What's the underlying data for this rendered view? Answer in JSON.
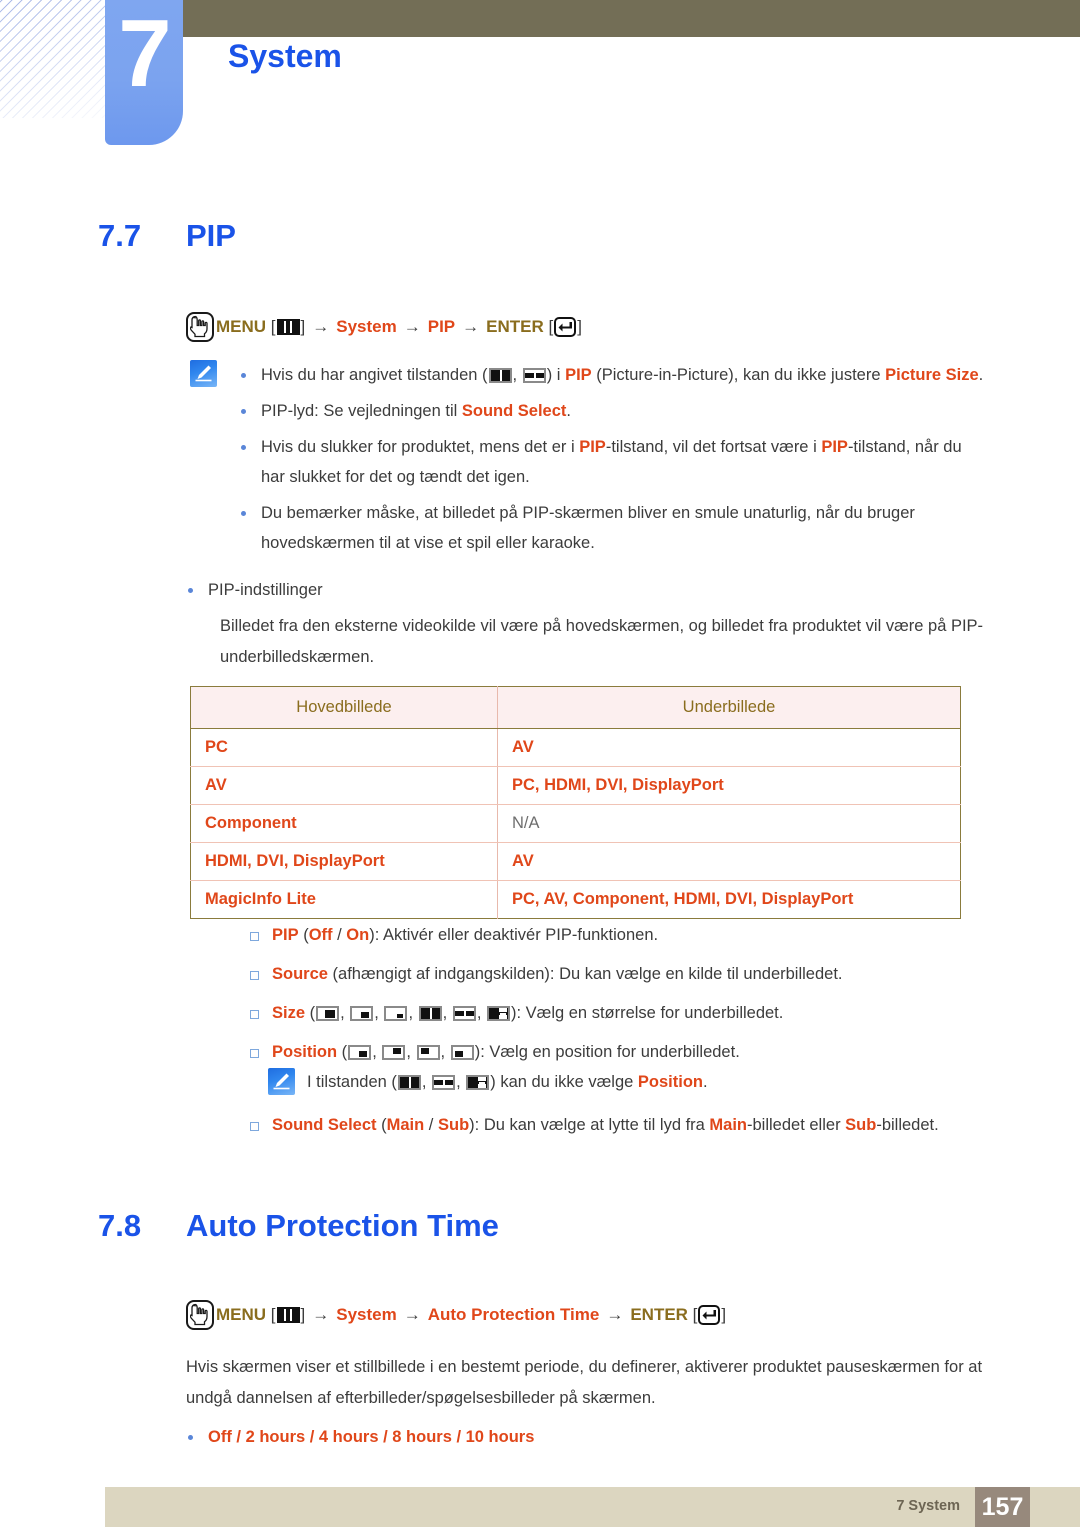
{
  "chapter": {
    "number": "7",
    "title": "System"
  },
  "sections": [
    {
      "num": "7.7",
      "title": "PIP",
      "menupath": {
        "menu_label": "MENU",
        "enter_label": "ENTER",
        "arrow": "→",
        "steps": [
          "System",
          "PIP"
        ]
      }
    },
    {
      "num": "7.8",
      "title": "Auto Protection Time",
      "menupath": {
        "menu_label": "MENU",
        "enter_label": "ENTER",
        "arrow": "→",
        "steps": [
          "System",
          "Auto Protection Time"
        ]
      }
    }
  ],
  "pip_notes": {
    "note1_pre": "Hvis du har angivet tilstanden (",
    "note1_mid": ") i ",
    "note1_pip": "PIP",
    "note1_after": " (Picture-in-Picture), kan du ikke justere ",
    "note1_picture_size": "Picture Size",
    "note1_end": ".",
    "note2_pre": "PIP-lyd: Se vejledningen til ",
    "note2_bold": "Sound Select",
    "note2_end": ".",
    "note3_a": "Hvis du slukker for produktet, mens det er i ",
    "note3_pip1": "PIP",
    "note3_b": "-tilstand, vil det fortsat være i ",
    "note3_pip2": "PIP",
    "note3_c": "-tilstand, når du har slukket for det og tændt det igen.",
    "note4": "Du bemærker måske, at billedet på PIP-skærmen bliver en smule unaturlig, når du bruger hovedskærmen til at vise et spil eller karaoke."
  },
  "pip_settings": {
    "heading": "PIP-indstillinger",
    "paragraph": "Billedet fra den eksterne videokilde vil være på hovedskærmen, og billedet fra produktet vil være på PIP-underbilledskærmen."
  },
  "table": {
    "headers": [
      "Hovedbillede",
      "Underbillede"
    ],
    "rows": [
      {
        "main": "PC",
        "sub": "AV",
        "sub_na": false
      },
      {
        "main": "AV",
        "sub": "PC, HDMI, DVI, DisplayPort",
        "sub_na": false
      },
      {
        "main": "Component",
        "sub": "N/A",
        "sub_na": true
      },
      {
        "main": "HDMI, DVI, DisplayPort",
        "sub": "AV",
        "sub_na": false
      },
      {
        "main": "MagicInfo Lite",
        "sub": "PC, AV, Component, HDMI, DVI, DisplayPort",
        "sub_na": false
      }
    ]
  },
  "options": {
    "pip_label": "PIP",
    "pip_values": "Off / On",
    "pip_off": "Off",
    "pip_on": "On",
    "pip_desc": "): Aktivér eller deaktivér PIP-funktionen.",
    "source_label": "Source",
    "source_desc": " (afhængigt af indgangskilden): Du kan vælge en kilde til underbilledet.",
    "size_label": "Size",
    "size_desc": "): Vælg en størrelse for underbilledet.",
    "position_label": "Position",
    "position_desc": "): Vælg en position for underbilledet.",
    "note_position_pre": "I tilstanden (",
    "note_position_post": ") kan du ikke vælge ",
    "note_position_bold": "Position",
    "note_position_end": ".",
    "sound_label": "Sound Select",
    "sound_main": "Main",
    "sound_sub": "Sub",
    "sound_desc_a": "): Du kan vælge at lytte til lyd fra ",
    "sound_desc_b": "-billedet eller ",
    "sound_desc_c": "-billedet.",
    "icon_names": {
      "size": [
        "pip-size-small-br",
        "pip-size-medium-br",
        "pip-size-tiny-br",
        "pip-size-split-half",
        "pip-size-split-wide",
        "pip-size-split-dash"
      ],
      "position": [
        "pip-position-bottom-right",
        "pip-position-top-right",
        "pip-position-top-left",
        "pip-position-bottom-left"
      ]
    }
  },
  "auto_protection": {
    "paragraph": "Hvis skærmen viser et stillbillede i en bestemt periode, du definerer, aktiverer produktet pauseskærmen for at undgå dannelsen af efterbilleder/spøgelsesbilleder på skærmen.",
    "values": "Off / 2 hours / 4 hours / 8 hours / 10 hours"
  },
  "footer": {
    "chapter_text": "7 System",
    "page_number": "157"
  },
  "colors": {
    "blue_heading": "#1a53e8",
    "orange": "#e0471a",
    "olive": "#8a6d1e",
    "olive_bar": "#736e56",
    "tab_blue": "#7ba3ef",
    "footer_bg": "#dcd6c0",
    "page_badge": "#97897c",
    "table_header_bg": "#fcefef"
  }
}
